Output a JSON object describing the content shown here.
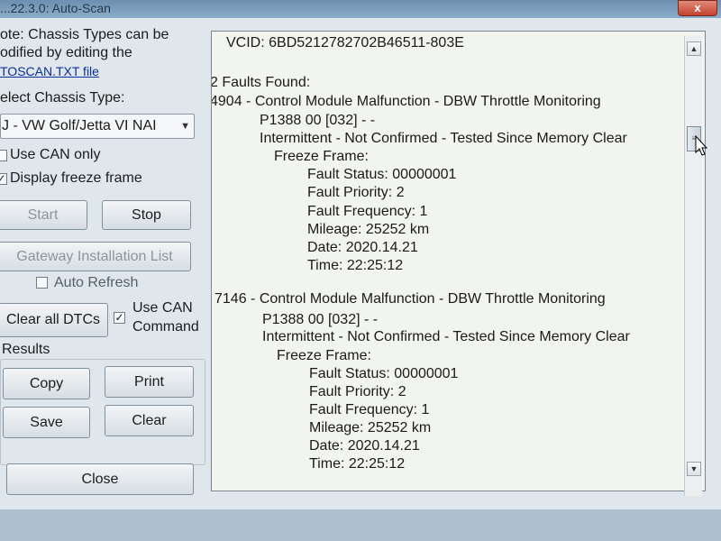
{
  "window": {
    "title": "...22.3.0: Auto-Scan",
    "close_glyph": "x"
  },
  "left_panel": {
    "note_line1": "ote:  Chassis Types can be",
    "note_line2": "odified by editing the",
    "note_link": "TOSCAN.TXT file",
    "select_label": "elect Chassis Type:",
    "chassis_value": "J - VW Golf/Jetta VI NAI",
    "use_can_only": {
      "label": "Use CAN only",
      "checked": false
    },
    "display_freeze": {
      "label": "Display freeze frame",
      "checked": true
    },
    "start_label": "Start",
    "stop_label": "Stop",
    "gateway_label": "Gateway Installation List",
    "auto_refresh": {
      "label": "Auto Refresh",
      "checked": false
    },
    "clear_dtcs_label": "Clear all DTCs",
    "use_can_command": {
      "line1": "Use CAN",
      "line2": "Command",
      "checked": true
    },
    "results_title": "Results",
    "copy_label": "Copy",
    "print_label": "Print",
    "save_label": "Save",
    "clear_label": "Clear",
    "close_label": "Close"
  },
  "output": {
    "vcid": "VCID: 6BD5212782702B46511-803E",
    "faults_found": "2 Faults Found:",
    "faults": [
      {
        "header": "4904 - Control Module Malfunction - DBW Throttle Monitoring",
        "code": "P1388 00 [032] - -",
        "status_text": "Intermittent - Not Confirmed - Tested Since Memory Clear",
        "freeze_frame_label": "Freeze Frame:",
        "fault_status": "Fault Status: 00000001",
        "fault_priority": "Fault Priority: 2",
        "fault_frequency": "Fault Frequency: 1",
        "mileage": "Mileage: 25252 km",
        "date": "Date: 2020.14.21",
        "time": "Time: 22:25:12"
      },
      {
        "header": "7146 - Control Module Malfunction - DBW Throttle Monitoring",
        "code": "P1388 00 [032] - -",
        "status_text": "Intermittent - Not Confirmed - Tested Since Memory Clear",
        "freeze_frame_label": "Freeze Frame:",
        "fault_status": "Fault Status: 00000001",
        "fault_priority": "Fault Priority: 2",
        "fault_frequency": "Fault Frequency: 1",
        "mileage": "Mileage: 25252 km",
        "date": "Date: 2020.14.21",
        "time": "Time: 22:25:12"
      }
    ]
  },
  "scrollbar": {
    "up_glyph": "▲",
    "down_glyph": "▼",
    "thumb_grip": "≡"
  }
}
